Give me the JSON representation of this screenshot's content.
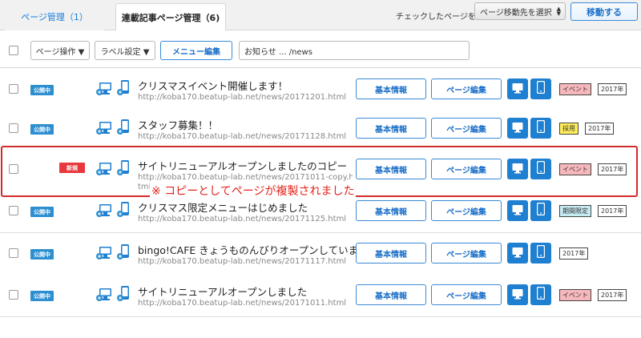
{
  "tabs": [
    {
      "label": "ページ管理（1）"
    },
    {
      "label": "連載記事ページ管理（6)"
    }
  ],
  "move": {
    "label": "チェックしたページを",
    "select_value": "ページ移動先を選択",
    "button": "移動する"
  },
  "toolbar": {
    "page_ops": "ページ操作 ▼",
    "label_settings": "ラベル設定 ▼",
    "menu_edit": "メニュー編集",
    "search_value": "お知らせ ... /news"
  },
  "row_buttons": {
    "basic": "基本情報",
    "edit": "ページ編集"
  },
  "status_labels": {
    "public": "公開中",
    "new": "新規"
  },
  "rows": [
    {
      "status": "公開中",
      "title": "クリスマスイベント開催します！",
      "url": "http://koba170.beatup-lab.net/news/20171201.html",
      "tags": [
        "イベント",
        "2017年"
      ]
    },
    {
      "status": "公開中",
      "title": "スタッフ募集！！",
      "url": "http://koba170.beatup-lab.net/news/20171128.html",
      "tags": [
        "採用",
        "2017年"
      ]
    },
    {
      "status": "新規",
      "title": "サイトリニューアルオープンしましたのコピー",
      "url": "http://koba170.beatup-lab.net/news/20171011-copy.html",
      "url_line2": "tml",
      "tags": [
        "イベント",
        "2017年"
      ]
    },
    {
      "status": "公開中",
      "title": "クリスマス限定メニューはじめました",
      "url": "http://koba170.beatup-lab.net/news/20171125.html",
      "tags": [
        "期間限定",
        "2017年"
      ]
    },
    {
      "status": "公開中",
      "title": "bingo!CAFE きょうものんびりオープンしています",
      "url": "http://koba170.beatup-lab.net/news/20171117.html",
      "tags": [
        "2017年"
      ]
    },
    {
      "status": "公開中",
      "title": "サイトリニューアルオープンしました",
      "url": "http://koba170.beatup-lab.net/news/20171011.html",
      "tags": [
        "イベント",
        "2017年"
      ]
    }
  ],
  "annotation": "※ コピーとしてページが複製されました",
  "colors": {
    "accent": "#1f7fd0",
    "highlight": "#d32a2a",
    "tag_event": "#f7b8bc",
    "tag_recruit": "#ffee58",
    "tag_limited": "#c6ecf3"
  },
  "icons": [
    "pc-preview-icon",
    "smartphone-preview-icon",
    "monitor-icon",
    "smartphone-icon"
  ]
}
